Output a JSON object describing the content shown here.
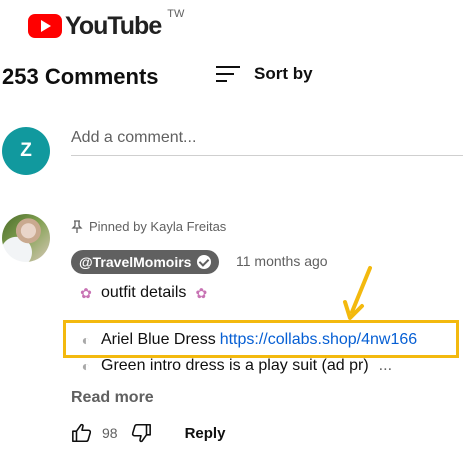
{
  "logo": {
    "text": "YouTube",
    "region": "TW"
  },
  "header": {
    "comment_count": "253 Comments",
    "sort_label": "Sort by"
  },
  "add_comment": {
    "avatar_letter": "Z",
    "placeholder": "Add a comment..."
  },
  "comment": {
    "pinned_text": "Pinned by Kayla Freitas",
    "author": "@TravelMomoirs",
    "timestamp": "11 months ago",
    "lines": {
      "first": "outfit details",
      "second_text": "Ariel Blue Dress",
      "second_link": "https://collabs.shop/4nw166",
      "third": "Green intro dress is a play suit (ad pr)",
      "third_ellipsis": "..."
    },
    "read_more": "Read more",
    "like_count": "98",
    "reply_label": "Reply"
  },
  "colors": {
    "brand": "#ff0000",
    "link": "#065fd4",
    "highlight": "#f3b90e",
    "avatar_z": "#11999e"
  },
  "icons": [
    "youtube-play-icon",
    "sort-icon",
    "pin-icon",
    "verified-check-icon",
    "mermaid-emoji-icon",
    "shell-emoji-icon",
    "thumbs-up-icon",
    "thumbs-down-icon"
  ]
}
